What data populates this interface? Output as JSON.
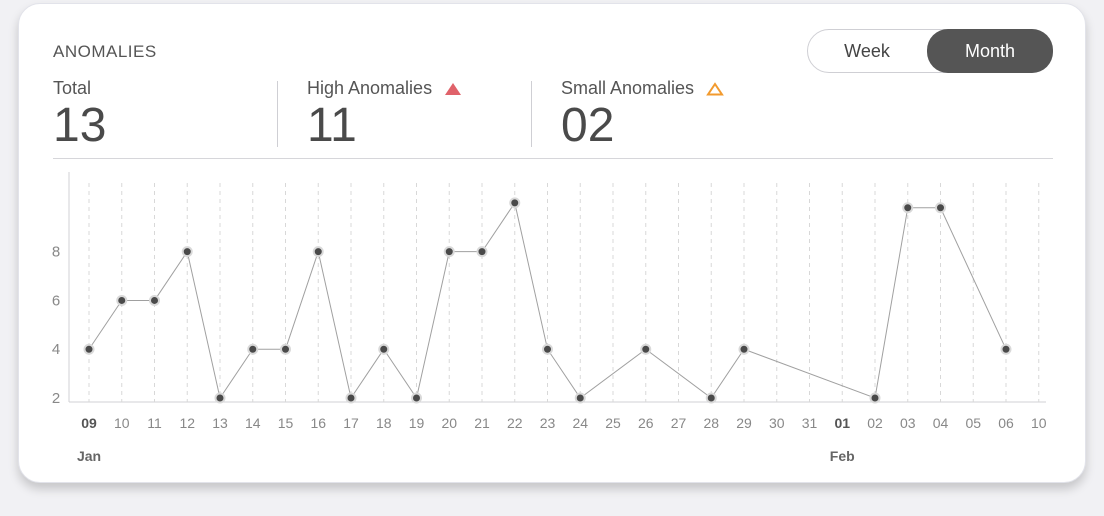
{
  "header": {
    "title": "ANOMALIES",
    "toggle": {
      "week_label": "Week",
      "month_label": "Month",
      "selected": "Month"
    }
  },
  "stats": {
    "total": {
      "label": "Total",
      "value": "13"
    },
    "high": {
      "label": "High Anomalies",
      "value": "11",
      "icon": "triangle-filled-icon",
      "color": "#e0626a"
    },
    "small": {
      "label": "Small Anomalies",
      "value": "02",
      "icon": "triangle-outline-icon",
      "color": "#f29a2e"
    }
  },
  "colors": {
    "line": "#a0a0a0",
    "point": "#4a4a4a",
    "grid": "#d8d8d8",
    "tick": "#888888"
  },
  "chart_data": {
    "type": "line",
    "x": [
      "09",
      "10",
      "11",
      "12",
      "13",
      "14",
      "15",
      "16",
      "17",
      "18",
      "19",
      "20",
      "21",
      "22",
      "23",
      "24",
      "25",
      "26",
      "27",
      "28",
      "29",
      "30",
      "31",
      "01",
      "02",
      "03",
      "04",
      "05",
      "06",
      "10"
    ],
    "month_labels": [
      {
        "label": "Jan",
        "at": "09"
      },
      {
        "label": "Feb",
        "at": "01"
      }
    ],
    "bold_ticks": [
      "09",
      "01"
    ],
    "yticks": [
      2,
      4,
      6,
      8
    ],
    "ylim": [
      2,
      10.2
    ],
    "series": [
      {
        "points": [
          [
            "09",
            4
          ],
          [
            "10",
            6
          ],
          [
            "11",
            6
          ],
          [
            "12",
            8
          ],
          [
            "13",
            2
          ],
          [
            "14",
            4
          ],
          [
            "15",
            4
          ],
          [
            "16",
            8
          ],
          [
            "17",
            2
          ],
          [
            "18",
            4
          ],
          [
            "19",
            2
          ],
          [
            "20",
            8
          ],
          [
            "21",
            8
          ],
          [
            "22",
            10
          ],
          [
            "23",
            4
          ],
          [
            "24",
            2
          ],
          [
            "26",
            4
          ],
          [
            "28",
            2
          ],
          [
            "29",
            4
          ],
          [
            "02",
            2
          ],
          [
            "03",
            9.8
          ],
          [
            "04",
            9.8
          ],
          [
            "06",
            4
          ]
        ]
      }
    ],
    "grid": "vertical-dashed"
  }
}
